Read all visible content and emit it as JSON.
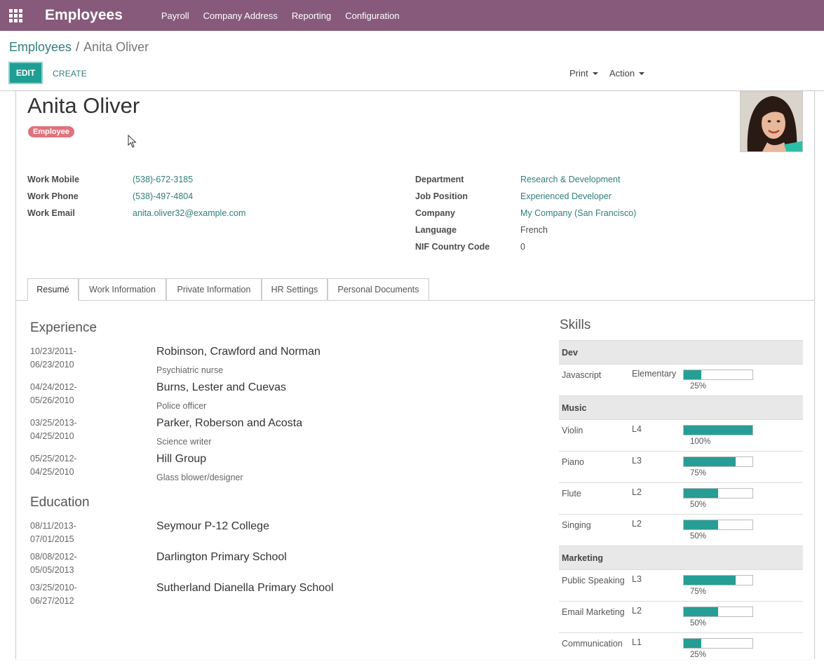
{
  "navbar": {
    "brand": "Employees",
    "menu": [
      "Payroll",
      "Company Address",
      "Reporting",
      "Configuration"
    ]
  },
  "breadcrumb": {
    "parent": "Employees",
    "separator": "/",
    "current": "Anita Oliver"
  },
  "buttons": {
    "edit": "EDIT",
    "create": "CREATE",
    "print": "Print",
    "action": "Action"
  },
  "employee": {
    "name": "Anita Oliver",
    "tag": "Employee"
  },
  "left_fields": [
    {
      "label": "Work Mobile",
      "value": "(538)-672-3185",
      "link": true
    },
    {
      "label": "Work Phone",
      "value": "(538)-497-4804",
      "link": true
    },
    {
      "label": "Work Email",
      "value": "anita.oliver32@example.com",
      "link": true
    }
  ],
  "right_fields": [
    {
      "label": "Department",
      "value": "Research & Development",
      "link": true
    },
    {
      "label": "Job Position",
      "value": "Experienced Developer",
      "link": true
    },
    {
      "label": "Company",
      "value": "My Company (San Francisco)",
      "link": true
    },
    {
      "label": "Language",
      "value": "French",
      "link": false
    },
    {
      "label": "NIF Country Code",
      "value": "0",
      "link": false
    }
  ],
  "tabs": [
    "Resumé",
    "Work Information",
    "Private Information",
    "HR Settings",
    "Personal Documents"
  ],
  "resume": {
    "experience_title": "Experience",
    "experience": [
      {
        "start": "10/23/2011-",
        "end": "06/23/2010",
        "org": "Robinson, Crawford and Norman",
        "role": "Psychiatric nurse"
      },
      {
        "start": "04/24/2012-",
        "end": "05/26/2010",
        "org": "Burns, Lester and Cuevas",
        "role": "Police officer"
      },
      {
        "start": "03/25/2013-",
        "end": "04/25/2010",
        "org": "Parker, Roberson and Acosta",
        "role": "Science writer"
      },
      {
        "start": "05/25/2012-",
        "end": "04/25/2010",
        "org": "Hill Group",
        "role": "Glass blower/designer"
      }
    ],
    "education_title": "Education",
    "education": [
      {
        "start": "08/11/2013-",
        "end": "07/01/2015",
        "org": "Seymour P-12 College"
      },
      {
        "start": "08/08/2012-",
        "end": "05/05/2013",
        "org": "Darlington Primary School"
      },
      {
        "start": "03/25/2010-",
        "end": "06/27/2012",
        "org": "Sutherland Dianella Primary School"
      }
    ]
  },
  "skills": {
    "title": "Skills",
    "groups": [
      {
        "name": "Dev",
        "items": [
          {
            "name": "Javascript",
            "level": "Elementary",
            "progress": 25,
            "pct": "25%"
          }
        ]
      },
      {
        "name": "Music",
        "items": [
          {
            "name": "Violin",
            "level": "L4",
            "progress": 100,
            "pct": "100%"
          },
          {
            "name": "Piano",
            "level": "L3",
            "progress": 75,
            "pct": "75%"
          },
          {
            "name": "Flute",
            "level": "L2",
            "progress": 50,
            "pct": "50%"
          },
          {
            "name": "Singing",
            "level": "L2",
            "progress": 50,
            "pct": "50%"
          }
        ]
      },
      {
        "name": "Marketing",
        "items": [
          {
            "name": "Public Speaking",
            "level": "L3",
            "progress": 75,
            "pct": "75%"
          },
          {
            "name": "Email Marketing",
            "level": "L2",
            "progress": 50,
            "pct": "50%"
          },
          {
            "name": "Communication",
            "level": "L1",
            "progress": 25,
            "pct": "25%"
          }
        ]
      }
    ]
  },
  "colors": {
    "navbar": "#875a7b",
    "accent": "#1f9e94",
    "link": "#2f7f7c",
    "tag": "#e0727b"
  }
}
